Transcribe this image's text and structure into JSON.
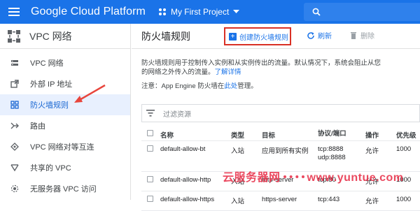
{
  "topbar": {
    "brand": "Google Cloud Platform",
    "project": "My First Project",
    "color": "#1a73e8"
  },
  "sidebar": {
    "header_title": "VPC 网络",
    "items": [
      {
        "label": "VPC 网络",
        "icon": "vpc-network-icon"
      },
      {
        "label": "外部 IP 地址",
        "icon": "external-ip-icon"
      },
      {
        "label": "防火墙规则",
        "icon": "firewall-icon",
        "active": true
      },
      {
        "label": "路由",
        "icon": "routes-icon"
      },
      {
        "label": "VPC 网络对等互连",
        "icon": "peering-icon"
      },
      {
        "label": "共享的 VPC",
        "icon": "shared-vpc-icon"
      },
      {
        "label": "无服务器 VPC 访问",
        "icon": "serverless-icon"
      }
    ]
  },
  "main": {
    "title": "防火墙规则",
    "create_label": "创建防火墙规则",
    "refresh_label": "刷新",
    "delete_label": "删除",
    "desc_line1": "防火墙规则用于控制传入实例和从实例传出的流量。默认情况下，系统会阻止从您",
    "desc_line2": "的网络之外传入的流量。",
    "desc_link": "了解详情",
    "note_prefix": "注意：App Engine 防火墙在",
    "note_link": "此处",
    "note_suffix": "管理。",
    "filter_placeholder": "过滤资源"
  },
  "table": {
    "headers": {
      "name": "名称",
      "type": "类型",
      "target": "目标",
      "proto": "协议/端口",
      "action": "操作",
      "priority": "优先级"
    },
    "rows": [
      {
        "name": "default-allow-bt",
        "type": "入站",
        "target": "应用到所有实例",
        "proto1": "tcp:8888",
        "proto2": "udp:8888",
        "action": "允许",
        "priority": "1000"
      },
      {
        "name": "default-allow-http",
        "type": "入站",
        "target": "http-server",
        "proto1": "tcp:80",
        "proto2": "",
        "action": "允许",
        "priority": "1000"
      },
      {
        "name": "default-allow-https",
        "type": "入站",
        "target": "https-server",
        "proto1": "tcp:443",
        "proto2": "",
        "action": "允许",
        "priority": "1000"
      }
    ]
  },
  "watermark": {
    "left": "云服务器网",
    "right": "www.yuntue.com",
    "color": "#e8304a"
  }
}
